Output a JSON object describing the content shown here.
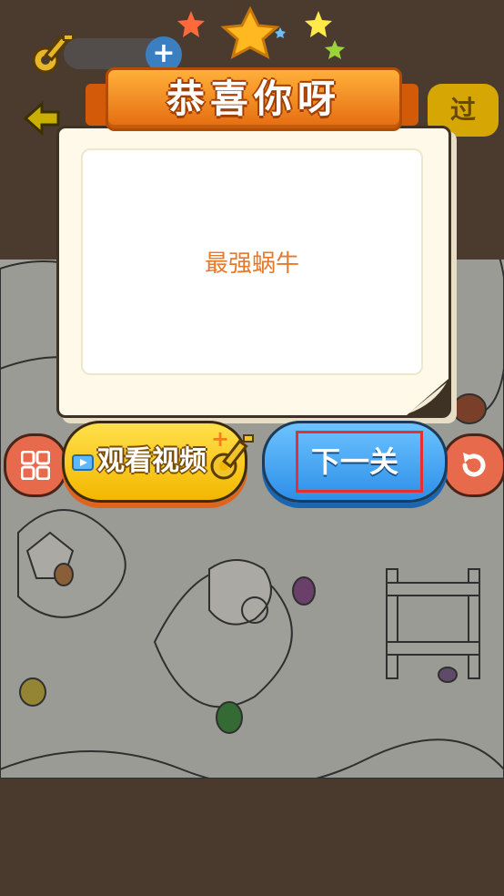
{
  "dialog": {
    "title": "恭喜你呀",
    "message": "最强蜗牛"
  },
  "buttons": {
    "watch_video": "观看视频",
    "next_level": "下一关",
    "skip": "过"
  },
  "hud": {
    "add_symbol": "+"
  },
  "icons": {
    "menu": "grid-icon",
    "restart": "restart-icon",
    "key": "key-icon",
    "back": "back-arrow-icon",
    "video": "video-icon"
  },
  "colors": {
    "ribbon": "#f08a1e",
    "next_button": "#3ea4f5",
    "watch_button": "#f9cb1a",
    "highlight": "#e43030"
  }
}
